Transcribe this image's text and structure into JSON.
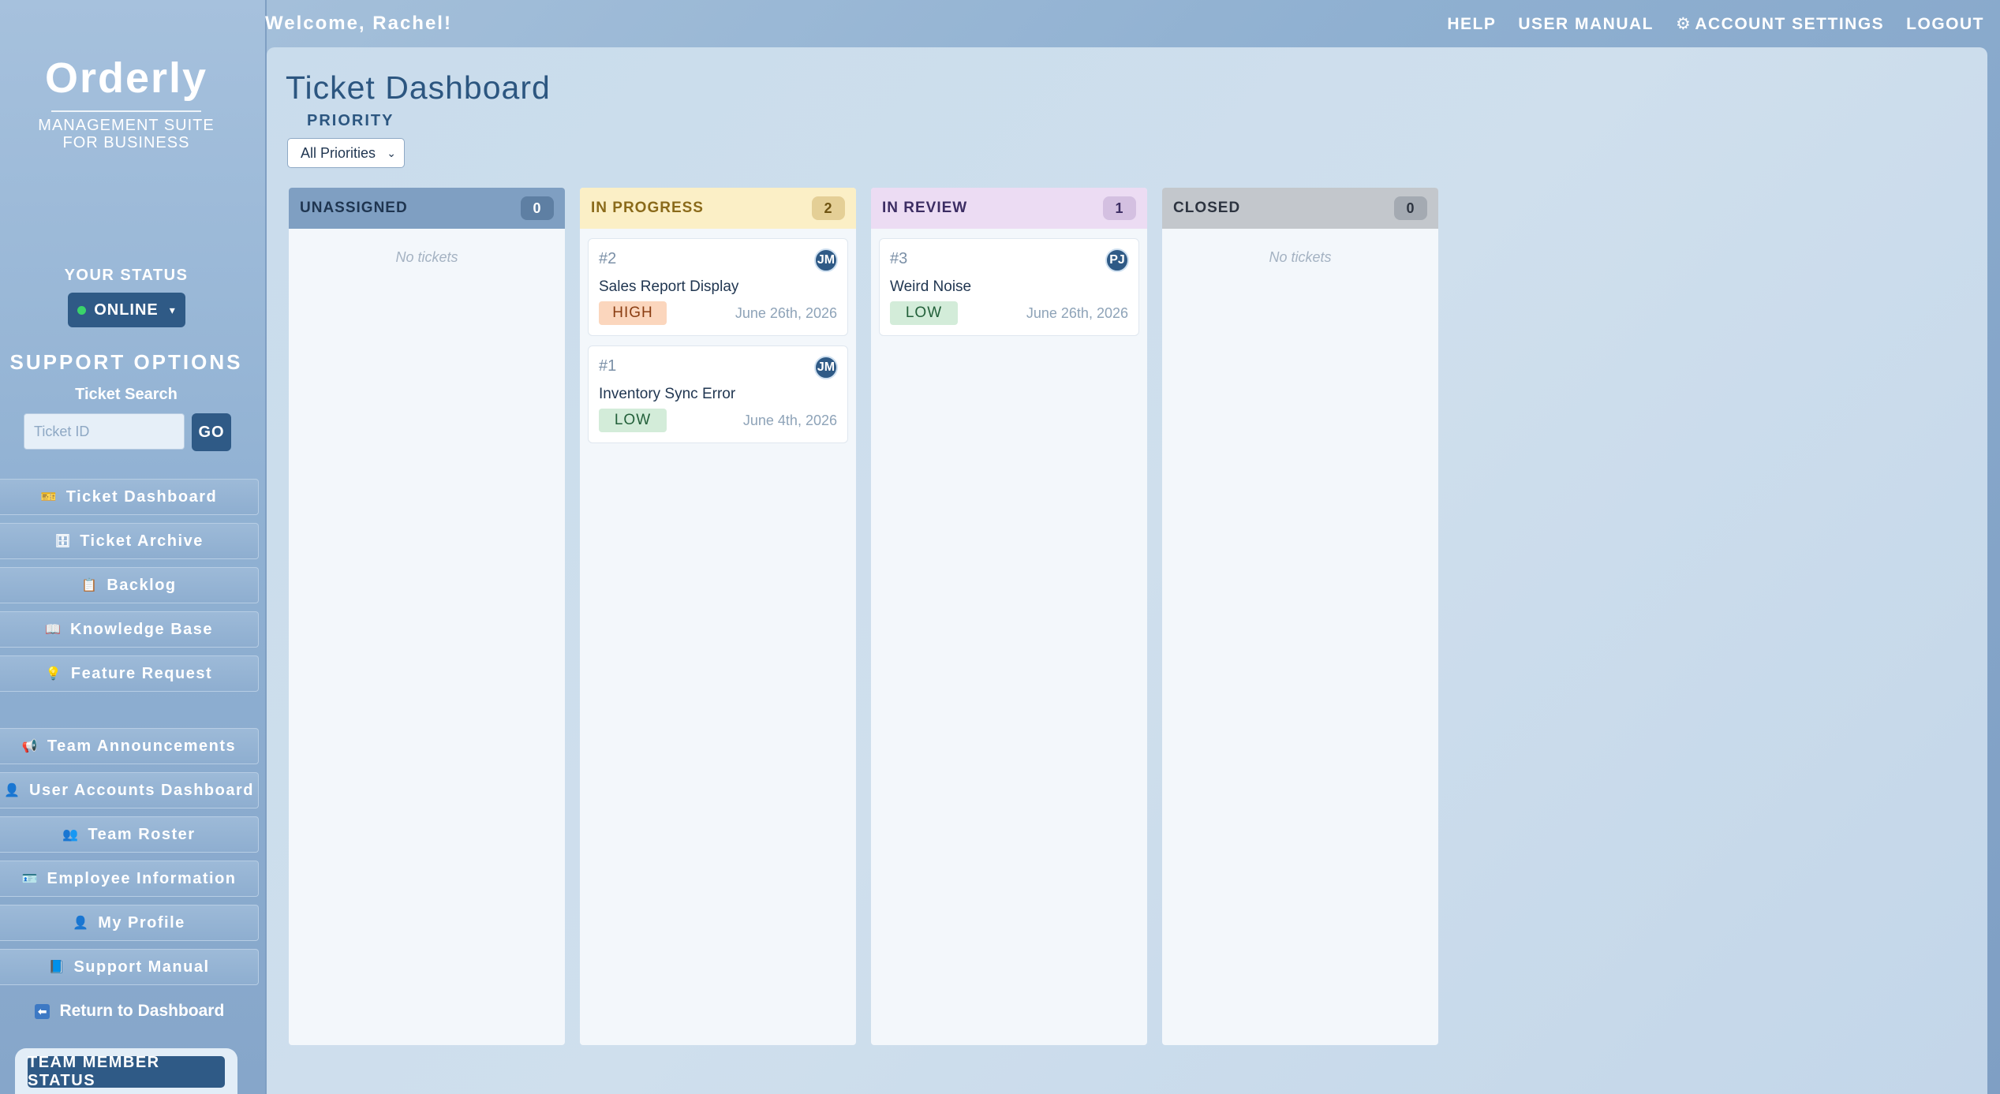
{
  "brand": {
    "name": "Orderly",
    "subtitle_line1": "MANAGEMENT SUITE",
    "subtitle_line2": "FOR BUSINESS"
  },
  "status": {
    "label": "YOUR STATUS",
    "value": "ONLINE",
    "dot_color": "#3ad36a"
  },
  "support": {
    "title": "SUPPORT OPTIONS",
    "search_label": "Ticket Search",
    "search_placeholder": "Ticket ID",
    "go_label": "GO"
  },
  "nav": {
    "items": [
      {
        "icon": "🎫",
        "icon_name": "ticket-icon",
        "label": "Ticket Dashboard"
      },
      {
        "icon": "🗄",
        "icon_name": "archive-icon",
        "label": "Ticket Archive"
      },
      {
        "icon": "📋",
        "icon_name": "clipboard-icon",
        "label": "Backlog"
      },
      {
        "icon": "📖",
        "icon_name": "book-icon",
        "label": "Knowledge Base"
      },
      {
        "icon": "💡",
        "icon_name": "lightbulb-icon",
        "label": "Feature Request"
      },
      {
        "icon": "📢",
        "icon_name": "megaphone-icon",
        "label": "Team Announcements"
      },
      {
        "icon": "👤",
        "icon_name": "user-icon",
        "label": "User Accounts Dashboard"
      },
      {
        "icon": "👥",
        "icon_name": "users-icon",
        "label": "Team Roster"
      },
      {
        "icon": "🪪",
        "icon_name": "id-card-icon",
        "label": "Employee Information"
      },
      {
        "icon": "👤",
        "icon_name": "profile-icon",
        "label": "My Profile"
      },
      {
        "icon": "📘",
        "icon_name": "manual-icon",
        "label": "Support Manual"
      }
    ],
    "return_icon": "⬅",
    "return_label": "Return to Dashboard",
    "team_status_label": "TEAM MEMBER STATUS"
  },
  "header": {
    "welcome": "Welcome, Rachel!",
    "links": {
      "help": "HELP",
      "manual": "USER MANUAL",
      "settings_icon": "⚙",
      "settings": "ACCOUNT SETTINGS",
      "logout": "LOGOUT"
    }
  },
  "main": {
    "title": "Ticket Dashboard",
    "filter_label": "PRIORITY",
    "filter_value": "All Priorities",
    "empty_text": "No tickets",
    "columns": [
      {
        "label": "UNASSIGNED",
        "count": "0"
      },
      {
        "label": "IN PROGRESS",
        "count": "2"
      },
      {
        "label": "IN REVIEW",
        "count": "1"
      },
      {
        "label": "CLOSED",
        "count": "0"
      }
    ],
    "tickets": {
      "in_progress": [
        {
          "num": "#2",
          "title": "Sales Report Display",
          "priority": "HIGH",
          "date": "June 26th, 2026",
          "avatar": "JM"
        },
        {
          "num": "#1",
          "title": "Inventory Sync Error",
          "priority": "LOW",
          "date": "June 4th, 2026",
          "avatar": "JM"
        }
      ],
      "in_review": [
        {
          "num": "#3",
          "title": "Weird Noise",
          "priority": "LOW",
          "date": "June 26th, 2026",
          "avatar": "PJ"
        }
      ]
    }
  }
}
